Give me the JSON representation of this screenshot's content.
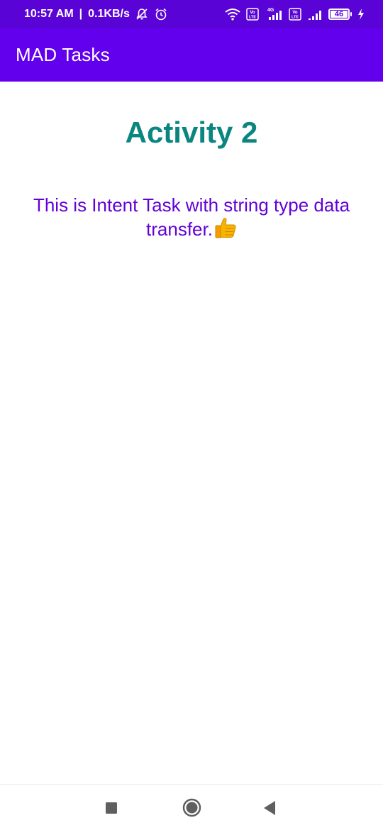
{
  "status_bar": {
    "time": "10:57 AM",
    "separator": "|",
    "data_speed": "0.1KB/s",
    "network_4g": "4G",
    "volte_1": "Vo LTE",
    "volte_2": "Vo LTE",
    "battery_level": "46",
    "icons": [
      "mute-notifications-icon",
      "alarm-icon",
      "wifi-icon",
      "volte-icon",
      "signal-icon",
      "volte-icon",
      "signal-icon",
      "battery-icon",
      "charging-icon"
    ]
  },
  "app_bar": {
    "title": "MAD Tasks",
    "background": "#6200ee"
  },
  "main": {
    "activity_title": "Activity 2",
    "activity_title_color": "#0b8580",
    "message": "This is Intent Task with string type data transfer.",
    "message_color": "#6200d8",
    "emoji": "thumbs-up-icon"
  },
  "nav_bar": {
    "buttons": [
      "recent-apps-icon",
      "home-icon",
      "back-icon"
    ]
  }
}
